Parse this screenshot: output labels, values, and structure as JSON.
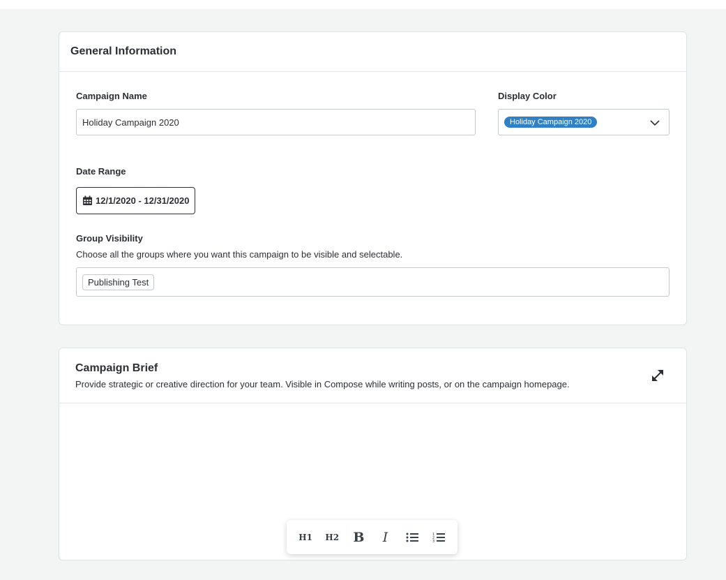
{
  "general": {
    "title": "General Information",
    "campaign_name_label": "Campaign Name",
    "campaign_name_value": "Holiday Campaign 2020",
    "display_color_label": "Display Color",
    "display_color_value": "Holiday Campaign 2020",
    "display_color_hex": "#2f80c5",
    "date_range_label": "Date Range",
    "date_range_value": "12/1/2020 - 12/31/2020",
    "group_visibility_label": "Group Visibility",
    "group_visibility_help": "Choose all the groups where you want this campaign to be visible and selectable.",
    "groups": [
      "Publishing Test"
    ]
  },
  "brief": {
    "title": "Campaign Brief",
    "description": "Provide strategic or creative direction for your team. Visible in Compose while writing posts, or on the campaign homepage.",
    "toolbar": {
      "h1": "H1",
      "h2": "H2",
      "bold": "B",
      "italic": "I"
    }
  },
  "icons": {
    "calendar": "calendar-icon",
    "chevron": "chevron-down-icon",
    "expand": "expand-icon",
    "bullet_list": "bullet-list-icon",
    "numbered_list": "numbered-list-icon"
  }
}
